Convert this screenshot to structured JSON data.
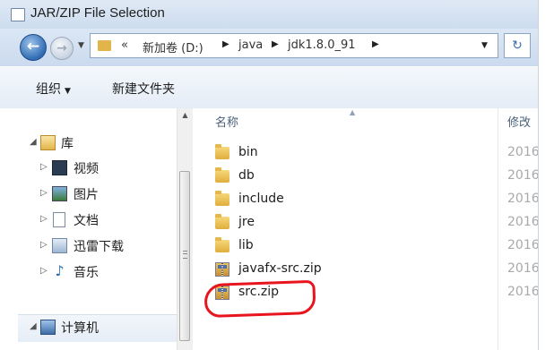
{
  "window": {
    "title": "JAR/ZIP File Selection"
  },
  "nav": {
    "breadcrumb_overflow": "«",
    "breadcrumb": [
      "新加卷 (D:)",
      "java",
      "jdk1.8.0_91"
    ]
  },
  "toolbar": {
    "organize": "组织",
    "new_folder": "新建文件夹"
  },
  "tree": {
    "library": "库",
    "items": [
      "视频",
      "图片",
      "文档",
      "迅雷下载",
      "音乐"
    ],
    "computer": "计算机"
  },
  "files": {
    "col_name": "名称",
    "col_modified": "修改",
    "rows": [
      {
        "name": "bin",
        "type": "folder",
        "date": "2016"
      },
      {
        "name": "db",
        "type": "folder",
        "date": "2016"
      },
      {
        "name": "include",
        "type": "folder",
        "date": "2016"
      },
      {
        "name": "jre",
        "type": "folder",
        "date": "2016"
      },
      {
        "name": "lib",
        "type": "folder",
        "date": "2016"
      },
      {
        "name": "javafx-src.zip",
        "type": "zip",
        "date": "2016"
      },
      {
        "name": "src.zip",
        "type": "zip",
        "date": "2016"
      }
    ]
  },
  "colors": {
    "highlight": "#e8141e",
    "accent": "#2f6cb3"
  },
  "icons": {
    "window": "window-icon",
    "back": "back-arrow-icon",
    "forward": "forward-arrow-icon",
    "folder": "folder-icon",
    "zip": "zip-archive-icon",
    "refresh": "refresh-icon"
  }
}
